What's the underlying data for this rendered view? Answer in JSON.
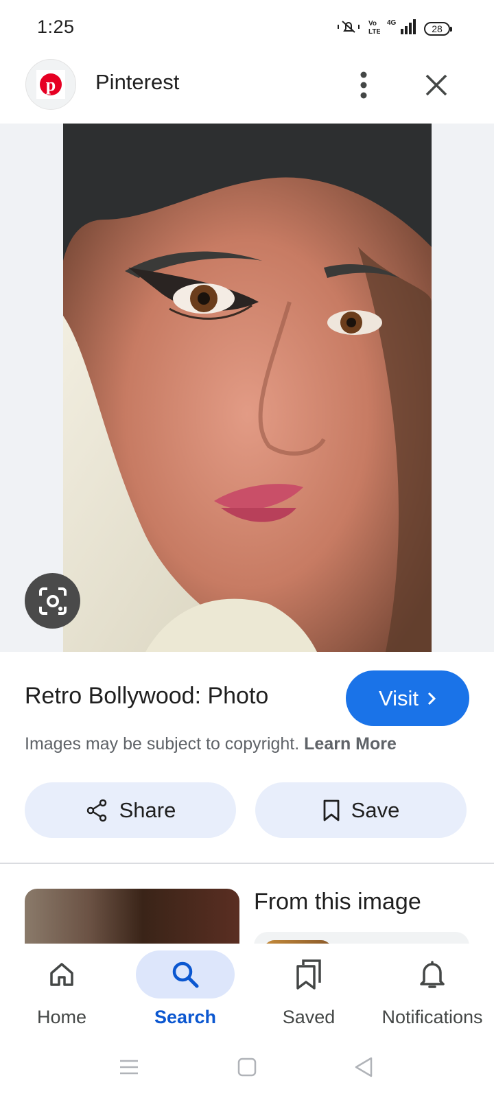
{
  "status_bar": {
    "time": "1:25",
    "battery": "28",
    "network": "4G"
  },
  "header": {
    "site_name": "Pinterest",
    "logo_letter": "p",
    "brand_color": "#e60023"
  },
  "result": {
    "title": "Retro Bollywood: Photo",
    "visit_label": "Visit",
    "copyright_text": "Images may be subject to copyright.",
    "learn_more_label": "Learn More",
    "share_label": "Share",
    "save_label": "Save",
    "accent_color": "#1a73e8"
  },
  "related": {
    "title": "From this image"
  },
  "bottom_nav": {
    "items": [
      {
        "label": "Home",
        "icon": "home-icon",
        "active": false
      },
      {
        "label": "Search",
        "icon": "search-icon",
        "active": true
      },
      {
        "label": "Saved",
        "icon": "saved-icon",
        "active": false
      },
      {
        "label": "Notifications",
        "icon": "bell-icon",
        "active": false
      }
    ]
  }
}
